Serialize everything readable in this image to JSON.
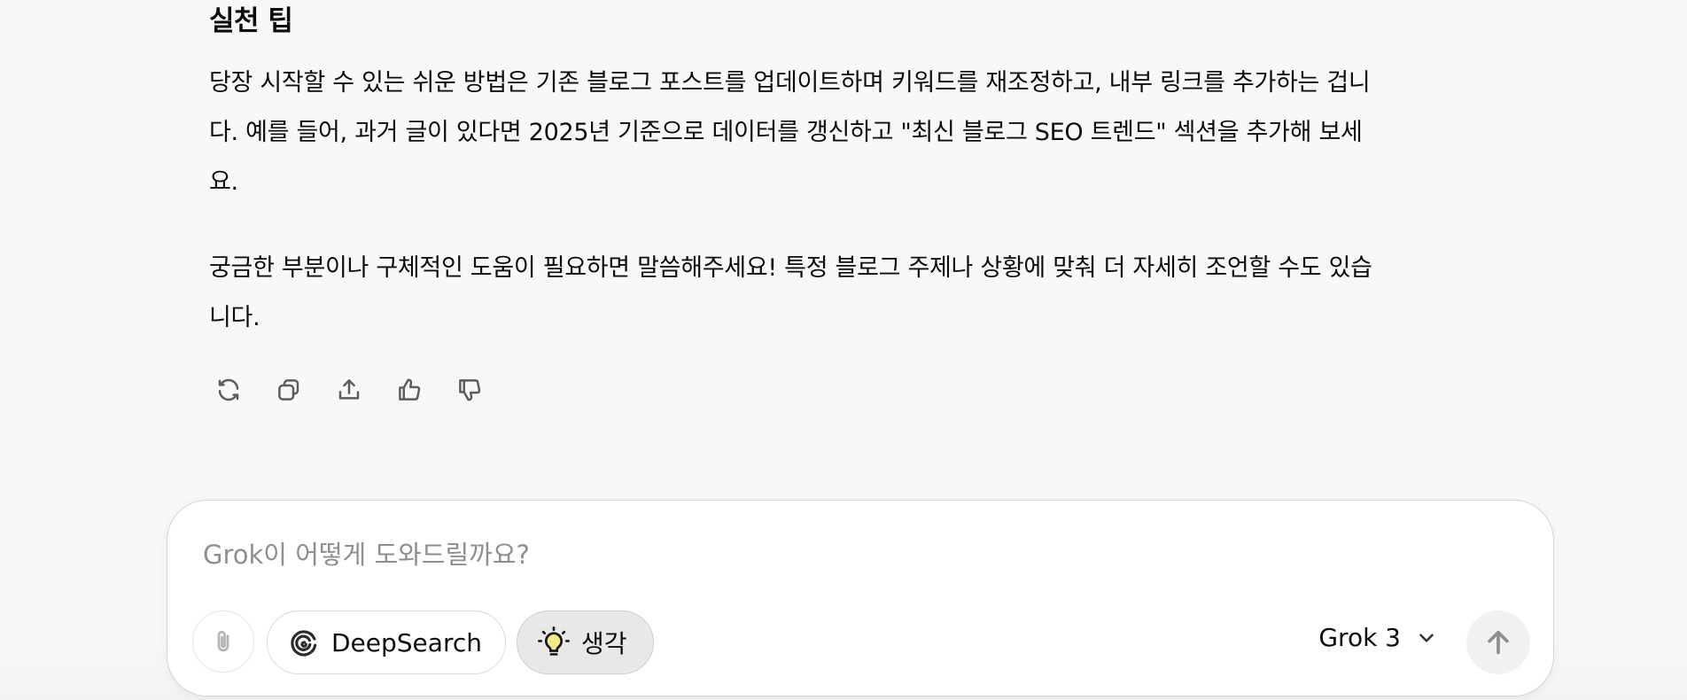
{
  "message": {
    "section_title": "실천 팁",
    "paragraph1_lines": [
      "당장 시작할 수 있는 쉬운 방법은 기존 블로그 포스트를 업데이트하며 키워드를 재조정하고, 내부 링크를 추가하는 겁니",
      "다. 예를 들어, 과거 글이 있다면 2025년 기준으로 데이터를 갱신하고 \"최신 블로그 SEO 트렌드\" 섹션을 추가해 보세",
      "요."
    ],
    "paragraph2_lines": [
      "궁금한 부분이나 구체적인 도움이 필요하면 말씀해주세요! 특정 블로그 주제나 상황에 맞춰 더 자세히 조언할 수도 있습",
      "니다."
    ],
    "actions": [
      {
        "icon": "regenerate-icon"
      },
      {
        "icon": "copy-icon"
      },
      {
        "icon": "share-icon"
      },
      {
        "icon": "thumbs-up-icon"
      },
      {
        "icon": "thumbs-down-icon"
      }
    ]
  },
  "composer": {
    "placeholder": "Grok이 어떻게 도와드릴까요?",
    "attach_icon": "paperclip-icon",
    "deepsearch_label": "DeepSearch",
    "deepsearch_icon": "spiral-icon",
    "think_label": "생각",
    "think_icon": "lightbulb-icon",
    "think_icon_color": "#f5e88a",
    "model_label": "Grok 3",
    "model_icon": "chevron-down-icon",
    "send_icon": "arrow-up-icon"
  }
}
